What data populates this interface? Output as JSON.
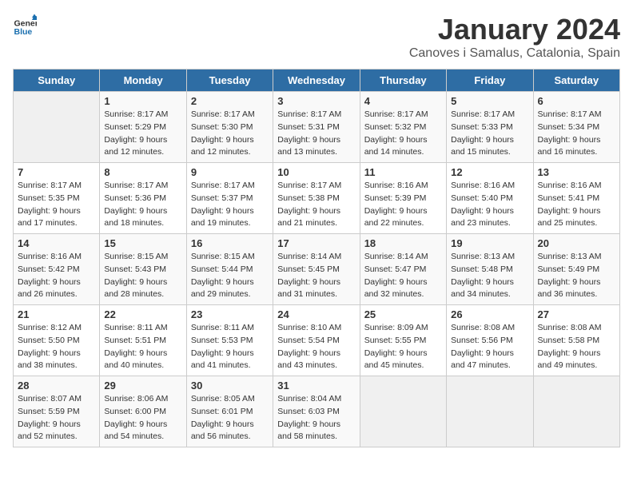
{
  "header": {
    "logo_general": "General",
    "logo_blue": "Blue",
    "title": "January 2024",
    "subtitle": "Canoves i Samalus, Catalonia, Spain"
  },
  "days_of_week": [
    "Sunday",
    "Monday",
    "Tuesday",
    "Wednesday",
    "Thursday",
    "Friday",
    "Saturday"
  ],
  "weeks": [
    [
      {
        "day": "",
        "sunrise": "",
        "sunset": "",
        "daylight": ""
      },
      {
        "day": "1",
        "sunrise": "Sunrise: 8:17 AM",
        "sunset": "Sunset: 5:29 PM",
        "daylight": "Daylight: 9 hours and 12 minutes."
      },
      {
        "day": "2",
        "sunrise": "Sunrise: 8:17 AM",
        "sunset": "Sunset: 5:30 PM",
        "daylight": "Daylight: 9 hours and 12 minutes."
      },
      {
        "day": "3",
        "sunrise": "Sunrise: 8:17 AM",
        "sunset": "Sunset: 5:31 PM",
        "daylight": "Daylight: 9 hours and 13 minutes."
      },
      {
        "day": "4",
        "sunrise": "Sunrise: 8:17 AM",
        "sunset": "Sunset: 5:32 PM",
        "daylight": "Daylight: 9 hours and 14 minutes."
      },
      {
        "day": "5",
        "sunrise": "Sunrise: 8:17 AM",
        "sunset": "Sunset: 5:33 PM",
        "daylight": "Daylight: 9 hours and 15 minutes."
      },
      {
        "day": "6",
        "sunrise": "Sunrise: 8:17 AM",
        "sunset": "Sunset: 5:34 PM",
        "daylight": "Daylight: 9 hours and 16 minutes."
      }
    ],
    [
      {
        "day": "7",
        "sunrise": "Sunrise: 8:17 AM",
        "sunset": "Sunset: 5:35 PM",
        "daylight": "Daylight: 9 hours and 17 minutes."
      },
      {
        "day": "8",
        "sunrise": "Sunrise: 8:17 AM",
        "sunset": "Sunset: 5:36 PM",
        "daylight": "Daylight: 9 hours and 18 minutes."
      },
      {
        "day": "9",
        "sunrise": "Sunrise: 8:17 AM",
        "sunset": "Sunset: 5:37 PM",
        "daylight": "Daylight: 9 hours and 19 minutes."
      },
      {
        "day": "10",
        "sunrise": "Sunrise: 8:17 AM",
        "sunset": "Sunset: 5:38 PM",
        "daylight": "Daylight: 9 hours and 21 minutes."
      },
      {
        "day": "11",
        "sunrise": "Sunrise: 8:16 AM",
        "sunset": "Sunset: 5:39 PM",
        "daylight": "Daylight: 9 hours and 22 minutes."
      },
      {
        "day": "12",
        "sunrise": "Sunrise: 8:16 AM",
        "sunset": "Sunset: 5:40 PM",
        "daylight": "Daylight: 9 hours and 23 minutes."
      },
      {
        "day": "13",
        "sunrise": "Sunrise: 8:16 AM",
        "sunset": "Sunset: 5:41 PM",
        "daylight": "Daylight: 9 hours and 25 minutes."
      }
    ],
    [
      {
        "day": "14",
        "sunrise": "Sunrise: 8:16 AM",
        "sunset": "Sunset: 5:42 PM",
        "daylight": "Daylight: 9 hours and 26 minutes."
      },
      {
        "day": "15",
        "sunrise": "Sunrise: 8:15 AM",
        "sunset": "Sunset: 5:43 PM",
        "daylight": "Daylight: 9 hours and 28 minutes."
      },
      {
        "day": "16",
        "sunrise": "Sunrise: 8:15 AM",
        "sunset": "Sunset: 5:44 PM",
        "daylight": "Daylight: 9 hours and 29 minutes."
      },
      {
        "day": "17",
        "sunrise": "Sunrise: 8:14 AM",
        "sunset": "Sunset: 5:45 PM",
        "daylight": "Daylight: 9 hours and 31 minutes."
      },
      {
        "day": "18",
        "sunrise": "Sunrise: 8:14 AM",
        "sunset": "Sunset: 5:47 PM",
        "daylight": "Daylight: 9 hours and 32 minutes."
      },
      {
        "day": "19",
        "sunrise": "Sunrise: 8:13 AM",
        "sunset": "Sunset: 5:48 PM",
        "daylight": "Daylight: 9 hours and 34 minutes."
      },
      {
        "day": "20",
        "sunrise": "Sunrise: 8:13 AM",
        "sunset": "Sunset: 5:49 PM",
        "daylight": "Daylight: 9 hours and 36 minutes."
      }
    ],
    [
      {
        "day": "21",
        "sunrise": "Sunrise: 8:12 AM",
        "sunset": "Sunset: 5:50 PM",
        "daylight": "Daylight: 9 hours and 38 minutes."
      },
      {
        "day": "22",
        "sunrise": "Sunrise: 8:11 AM",
        "sunset": "Sunset: 5:51 PM",
        "daylight": "Daylight: 9 hours and 40 minutes."
      },
      {
        "day": "23",
        "sunrise": "Sunrise: 8:11 AM",
        "sunset": "Sunset: 5:53 PM",
        "daylight": "Daylight: 9 hours and 41 minutes."
      },
      {
        "day": "24",
        "sunrise": "Sunrise: 8:10 AM",
        "sunset": "Sunset: 5:54 PM",
        "daylight": "Daylight: 9 hours and 43 minutes."
      },
      {
        "day": "25",
        "sunrise": "Sunrise: 8:09 AM",
        "sunset": "Sunset: 5:55 PM",
        "daylight": "Daylight: 9 hours and 45 minutes."
      },
      {
        "day": "26",
        "sunrise": "Sunrise: 8:08 AM",
        "sunset": "Sunset: 5:56 PM",
        "daylight": "Daylight: 9 hours and 47 minutes."
      },
      {
        "day": "27",
        "sunrise": "Sunrise: 8:08 AM",
        "sunset": "Sunset: 5:58 PM",
        "daylight": "Daylight: 9 hours and 49 minutes."
      }
    ],
    [
      {
        "day": "28",
        "sunrise": "Sunrise: 8:07 AM",
        "sunset": "Sunset: 5:59 PM",
        "daylight": "Daylight: 9 hours and 52 minutes."
      },
      {
        "day": "29",
        "sunrise": "Sunrise: 8:06 AM",
        "sunset": "Sunset: 6:00 PM",
        "daylight": "Daylight: 9 hours and 54 minutes."
      },
      {
        "day": "30",
        "sunrise": "Sunrise: 8:05 AM",
        "sunset": "Sunset: 6:01 PM",
        "daylight": "Daylight: 9 hours and 56 minutes."
      },
      {
        "day": "31",
        "sunrise": "Sunrise: 8:04 AM",
        "sunset": "Sunset: 6:03 PM",
        "daylight": "Daylight: 9 hours and 58 minutes."
      },
      {
        "day": "",
        "sunrise": "",
        "sunset": "",
        "daylight": ""
      },
      {
        "day": "",
        "sunrise": "",
        "sunset": "",
        "daylight": ""
      },
      {
        "day": "",
        "sunrise": "",
        "sunset": "",
        "daylight": ""
      }
    ]
  ]
}
